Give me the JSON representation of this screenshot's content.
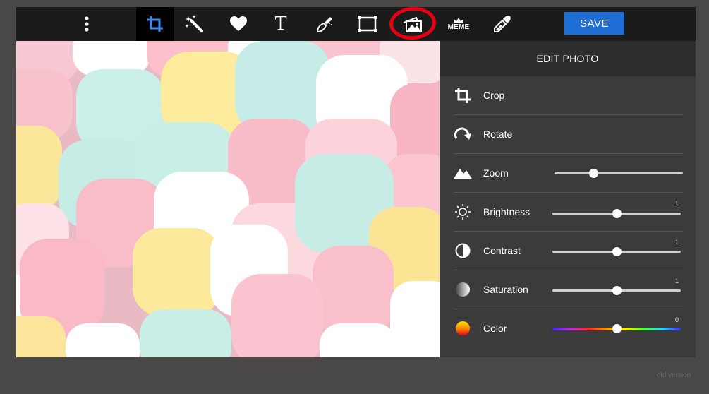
{
  "toolbar": {
    "buttons": [
      {
        "icon": "more-vertical-icon"
      },
      {
        "icon": "crop-icon",
        "active": true
      },
      {
        "icon": "magic-wand-icon"
      },
      {
        "icon": "heart-icon"
      },
      {
        "icon": "text-icon",
        "glyph": "T"
      },
      {
        "icon": "draw-brush-icon"
      },
      {
        "icon": "frame-icon"
      },
      {
        "icon": "overlay-images-icon",
        "highlighted": true
      },
      {
        "icon": "meme-icon",
        "label": "MEME"
      },
      {
        "icon": "eyedropper-icon"
      }
    ],
    "save_label": "SAVE"
  },
  "panel": {
    "title": "EDIT PHOTO",
    "tools": [
      {
        "icon": "crop-icon",
        "label": "Crop"
      },
      {
        "icon": "rotate-icon",
        "label": "Rotate"
      },
      {
        "icon": "zoom-mountain-icon",
        "label": "Zoom",
        "slider": 0.3
      },
      {
        "icon": "sun-icon",
        "label": "Brightness",
        "slider": 0.5,
        "value": "1"
      },
      {
        "icon": "contrast-icon",
        "label": "Contrast",
        "slider": 0.5,
        "value": "1"
      },
      {
        "icon": "saturation-icon",
        "label": "Saturation",
        "slider": 0.5,
        "value": "1"
      },
      {
        "icon": "color-icon",
        "label": "Color",
        "slider": 0.5,
        "value": "0"
      }
    ]
  },
  "footer": {
    "old_version": "old version"
  },
  "colors": {
    "accent": "#1f6fd6",
    "highlight": "#e60012",
    "toolbar_bg": "#1b1b1b",
    "panel_bg": "#3b3b3b"
  }
}
